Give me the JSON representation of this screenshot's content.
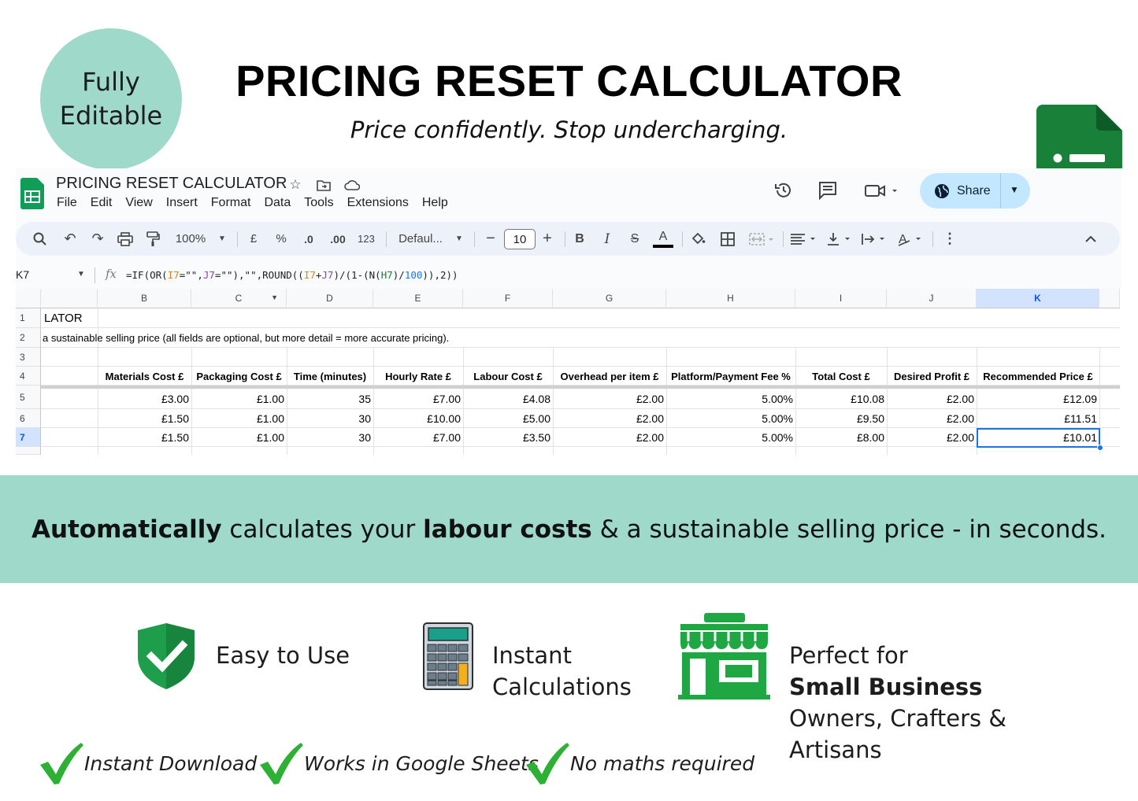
{
  "badge": {
    "line1": "Fully",
    "line2": "Editable"
  },
  "hero": {
    "title": "PRICING RESET CALCULATOR",
    "subtitle": "Price confidently. Stop undercharging."
  },
  "sheet": {
    "doc_title": "PRICING RESET CALCULATOR",
    "menu": [
      "File",
      "Edit",
      "View",
      "Insert",
      "Format",
      "Data",
      "Tools",
      "Extensions",
      "Help"
    ],
    "share_label": "Share",
    "toolbar": {
      "zoom": "100%",
      "currency": "£",
      "percent": "%",
      "dec_less": ".0",
      "dec_more": ".00",
      "number_format": "123",
      "font": "Defaul...",
      "font_size": "10"
    },
    "name_box": "K7",
    "formula_parts": {
      "p1": "=IF(OR(",
      "p2": "I7",
      "p3": "=\"\",",
      "p4": "J7",
      "p5": "=\"\"),\"\",ROUND((",
      "p6": "I7",
      "p7": "+",
      "p8": "J7",
      "p9": ")/(1-(N(",
      "p10": "H7",
      "p11": ")/",
      "p12": "100",
      "p13": ")),2))"
    },
    "columns": [
      "B",
      "C",
      "D",
      "E",
      "F",
      "G",
      "H",
      "I",
      "J",
      "K"
    ],
    "row_numbers": [
      "1",
      "2",
      "3",
      "4",
      "5",
      "6",
      "7"
    ],
    "row1_text": "LATOR",
    "row2_text": "a sustainable selling price (all fields are optional, but more detail = more accurate pricing).",
    "headers": [
      "Materials Cost £",
      "Packaging Cost £",
      "Time (minutes)",
      "Hourly Rate £",
      "Labour Cost £",
      "Overhead per item £",
      "Platform/Payment Fee %",
      "Total Cost £",
      "Desired Profit £",
      "Recommended Price £"
    ],
    "rows": [
      [
        "£3.00",
        "£1.00",
        "35",
        "£7.00",
        "£4.08",
        "£2.00",
        "5.00%",
        "£10.08",
        "£2.00",
        "£12.09"
      ],
      [
        "£1.50",
        "£1.00",
        "30",
        "£10.00",
        "£5.00",
        "£2.00",
        "5.00%",
        "£9.50",
        "£2.00",
        "£11.51"
      ],
      [
        "£1.50",
        "£1.00",
        "30",
        "£7.00",
        "£3.50",
        "£2.00",
        "5.00%",
        "£8.00",
        "£2.00",
        "£10.01"
      ]
    ]
  },
  "banner": {
    "bold1": "Automatically",
    "text1": " calculates your ",
    "bold2": "labour costs",
    "text2": " & a sustainable selling price - in seconds."
  },
  "features": {
    "easy": "Easy to Use",
    "instant_l1": "Instant",
    "instant_l2": "Calculations",
    "perfect_l1": "Perfect for",
    "perfect_l2": "Small Business",
    "perfect_l3": "Owners, Crafters &",
    "perfect_l4": "Artisans"
  },
  "checks": [
    "Instant Download",
    "Works in Google Sheets",
    "No maths required"
  ],
  "colors": {
    "mint": "#9fd9c9",
    "sheets_green": "#188038",
    "check_green": "#2db034",
    "shield_green": "#1e9e4a",
    "selection_blue": "#1a73e8"
  }
}
